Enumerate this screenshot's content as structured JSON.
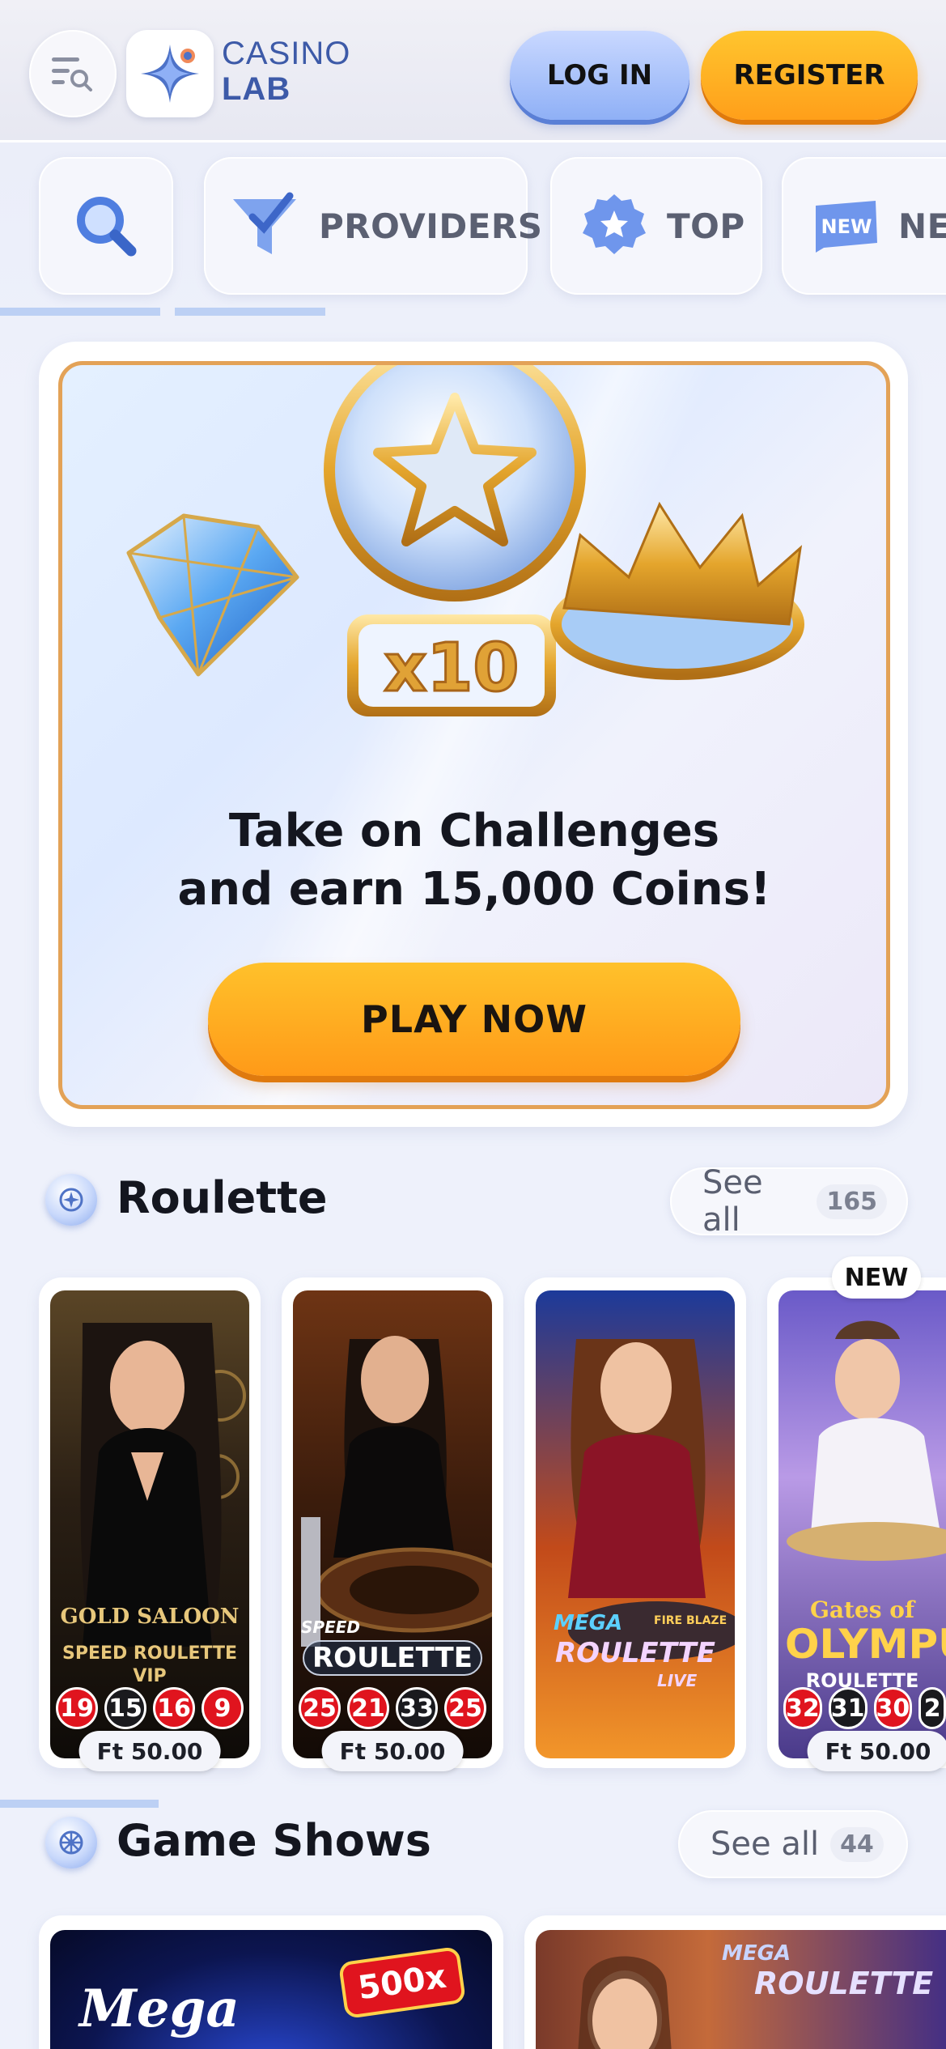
{
  "header": {
    "brand_line1": "CASINO",
    "brand_line2": "LAB",
    "login_label": "LOG IN",
    "register_label": "REGISTER",
    "icons": [
      "menu-search-icon",
      "casino-lab-star-logo"
    ]
  },
  "categories": [
    {
      "label": "",
      "icon": "search-icon"
    },
    {
      "label": "PROVIDERS",
      "icon": "funnel-icon"
    },
    {
      "label": "TOP",
      "icon": "star-badge-icon"
    },
    {
      "label": "NE",
      "icon": "new-tag-icon"
    }
  ],
  "banner": {
    "multiplier": "x10",
    "title_line1": "Take on Challenges",
    "title_line2": "and earn 15,000 Coins!",
    "cta_label": "PLAY NOW"
  },
  "roulette": {
    "title": "Roulette",
    "see_all": "See all",
    "count": "165",
    "new_badge": "NEW",
    "games": [
      {
        "line1": "GOLD SALOON",
        "line2": "SPEED ROULETTE",
        "line3": "VIP",
        "numbers": [
          "19",
          "15",
          "16",
          "9"
        ],
        "price": "Ft 50.00"
      },
      {
        "line1": "SPEED",
        "line2": "ROULETTE",
        "numbers": [
          "25",
          "21",
          "33",
          "25"
        ],
        "price": "Ft 50.00"
      },
      {
        "line1": "MEGA",
        "line2": "FIRE BLAZE",
        "line3": "ROULETTE",
        "line4": "LIVE"
      },
      {
        "line1": "Gates of",
        "line2": "OLYMPU",
        "line3": "ROULETTE",
        "numbers": [
          "32",
          "31",
          "30",
          "2"
        ],
        "price": "Ft 50.00"
      }
    ]
  },
  "game_shows": {
    "title": "Game Shows",
    "see_all": "See all",
    "count": "44",
    "games": [
      {
        "line1": "Mega",
        "badge": "500x"
      },
      {
        "line1": "MEGA",
        "line2": "ROULETTE"
      }
    ]
  },
  "colors": {
    "accent_orange": "#ffa51f",
    "accent_blue": "#9bb8f8",
    "roulette_red": "#e0141e",
    "roulette_black": "#1a1a1e"
  }
}
